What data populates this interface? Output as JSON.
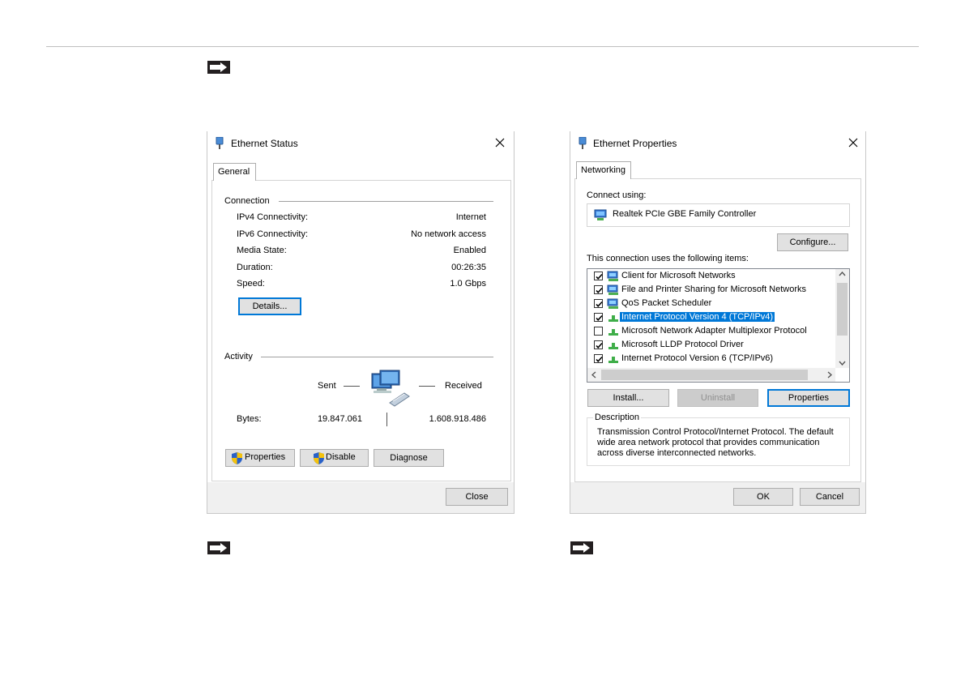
{
  "status_dialog": {
    "title": "Ethernet Status",
    "tab": "General",
    "connection": {
      "heading": "Connection",
      "rows": [
        {
          "label": "IPv4 Connectivity:",
          "value": "Internet"
        },
        {
          "label": "IPv6 Connectivity:",
          "value": "No network access"
        },
        {
          "label": "Media State:",
          "value": "Enabled"
        },
        {
          "label": "Duration:",
          "value": "00:26:35"
        },
        {
          "label": "Speed:",
          "value": "1.0 Gbps"
        }
      ],
      "details_button": "Details..."
    },
    "activity": {
      "heading": "Activity",
      "sent_label": "Sent",
      "received_label": "Received",
      "bytes_label": "Bytes:",
      "bytes_sent": "19.847.061",
      "bytes_received": "1.608.918.486"
    },
    "buttons": {
      "properties": "Properties",
      "disable": "Disable",
      "diagnose": "Diagnose",
      "close": "Close"
    }
  },
  "properties_dialog": {
    "title": "Ethernet Properties",
    "tab": "Networking",
    "connect_using_label": "Connect using:",
    "adapter_name": "Realtek PCIe GBE Family Controller",
    "configure_button": "Configure...",
    "items_label": "This connection uses the following items:",
    "items": [
      {
        "label": "Client for Microsoft Networks",
        "checked": true,
        "icon": "network-client-icon"
      },
      {
        "label": "File and Printer Sharing for Microsoft Networks",
        "checked": true,
        "icon": "network-service-icon"
      },
      {
        "label": "QoS Packet Scheduler",
        "checked": true,
        "icon": "network-service-icon"
      },
      {
        "label": "Internet Protocol Version 4 (TCP/IPv4)",
        "checked": true,
        "icon": "protocol-icon",
        "selected": true
      },
      {
        "label": "Microsoft Network Adapter Multiplexor Protocol",
        "checked": false,
        "icon": "protocol-icon"
      },
      {
        "label": "Microsoft LLDP Protocol Driver",
        "checked": true,
        "icon": "protocol-icon"
      },
      {
        "label": "Internet Protocol Version 6 (TCP/IPv6)",
        "checked": true,
        "icon": "protocol-icon"
      }
    ],
    "install_button": "Install...",
    "uninstall_button": "Uninstall",
    "properties_button": "Properties",
    "description_heading": "Description",
    "description_text": "Transmission Control Protocol/Internet Protocol. The default wide area network protocol that provides communication across diverse interconnected networks.",
    "ok_button": "OK",
    "cancel_button": "Cancel"
  },
  "colors": {
    "accent": "#0078d7",
    "selection": "#0078d7",
    "arrow": "#231f20"
  }
}
